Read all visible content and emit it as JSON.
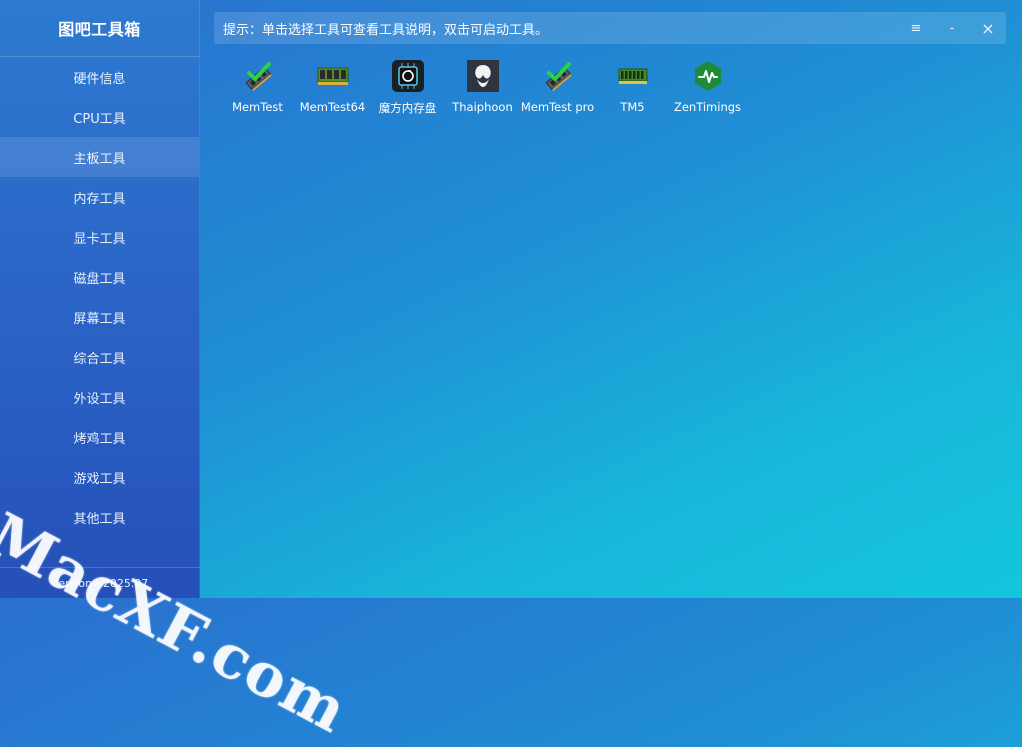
{
  "app": {
    "title": "图吧工具箱",
    "version": "Version : 2025.07"
  },
  "sidebar": {
    "items": [
      {
        "label": "硬件信息",
        "active": false
      },
      {
        "label": "CPU工具",
        "active": false
      },
      {
        "label": "主板工具",
        "active": true
      },
      {
        "label": "内存工具",
        "active": false
      },
      {
        "label": "显卡工具",
        "active": false
      },
      {
        "label": "磁盘工具",
        "active": false
      },
      {
        "label": "屏幕工具",
        "active": false
      },
      {
        "label": "综合工具",
        "active": false
      },
      {
        "label": "外设工具",
        "active": false
      },
      {
        "label": "烤鸡工具",
        "active": false
      },
      {
        "label": "游戏工具",
        "active": false
      },
      {
        "label": "其他工具",
        "active": false
      }
    ]
  },
  "hint": {
    "text": "提示：单击选择工具可查看工具说明，双击可启动工具。"
  },
  "window_controls": {
    "menu": "≡",
    "minimize": "-",
    "close": "×"
  },
  "tools": [
    {
      "label": "MemTest",
      "icon": "memtest-icon"
    },
    {
      "label": "MemTest64",
      "icon": "ram-module-icon"
    },
    {
      "label": "魔方内存盘",
      "icon": "ramdisk-chip-icon"
    },
    {
      "label": "Thaiphoon",
      "icon": "thaiphoon-icon"
    },
    {
      "label": "MemTest pro",
      "icon": "memtest-pro-icon"
    },
    {
      "label": "TM5",
      "icon": "tm5-ram-icon"
    },
    {
      "label": "ZenTimings",
      "icon": "zentimings-icon"
    }
  ],
  "watermark": "MacXF.com",
  "colors": {
    "sidebar_active_bg": "rgba(255,255,255,0.12)",
    "accent_green": "#2db34a"
  }
}
